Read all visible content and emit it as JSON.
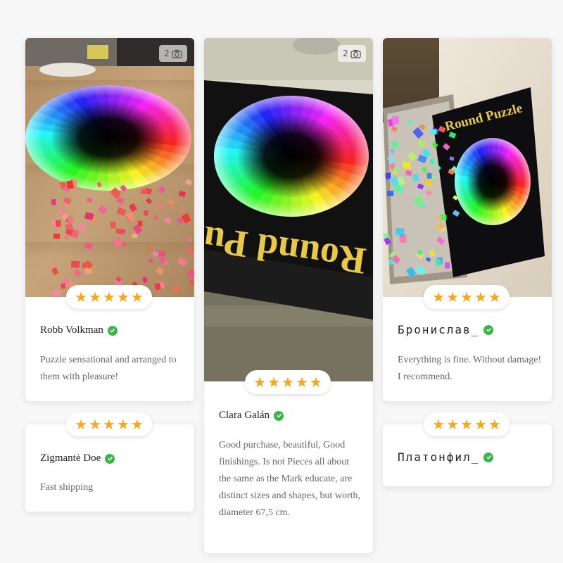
{
  "reviews": [
    {
      "photo_count": "2",
      "rating": 5,
      "author": "Robb Volkman",
      "verified": true,
      "text": "Puzzle sensational and arranged to them with pleasure!"
    },
    {
      "photo_count": "2",
      "rating": 5,
      "author": "Clara Galán",
      "verified": true,
      "text": "Good purchase, beautiful, Good finishings. Is not Pieces all about the same as the Mark educate, are distinct sizes and shapes, but worth, diameter 67,5 cm.",
      "photo_box_text": "Round Puzz"
    },
    {
      "rating": 5,
      "author": "Бронислав_",
      "verified": true,
      "text": "Everything is fine. Without damage! I recommend.",
      "photo_box_text": "Round Puzzle"
    },
    {
      "rating": 5,
      "author": "Zigmantė Doe",
      "verified": true,
      "text": "Fast shipping"
    },
    {
      "rating": 5,
      "author": "Платонфил_",
      "verified": true,
      "text": ""
    }
  ],
  "icons": {
    "star": "star-icon",
    "verified": "verified-check-icon",
    "camera": "camera-icon"
  },
  "colors": {
    "star": "#f5a623",
    "verified": "#3bb54a"
  }
}
